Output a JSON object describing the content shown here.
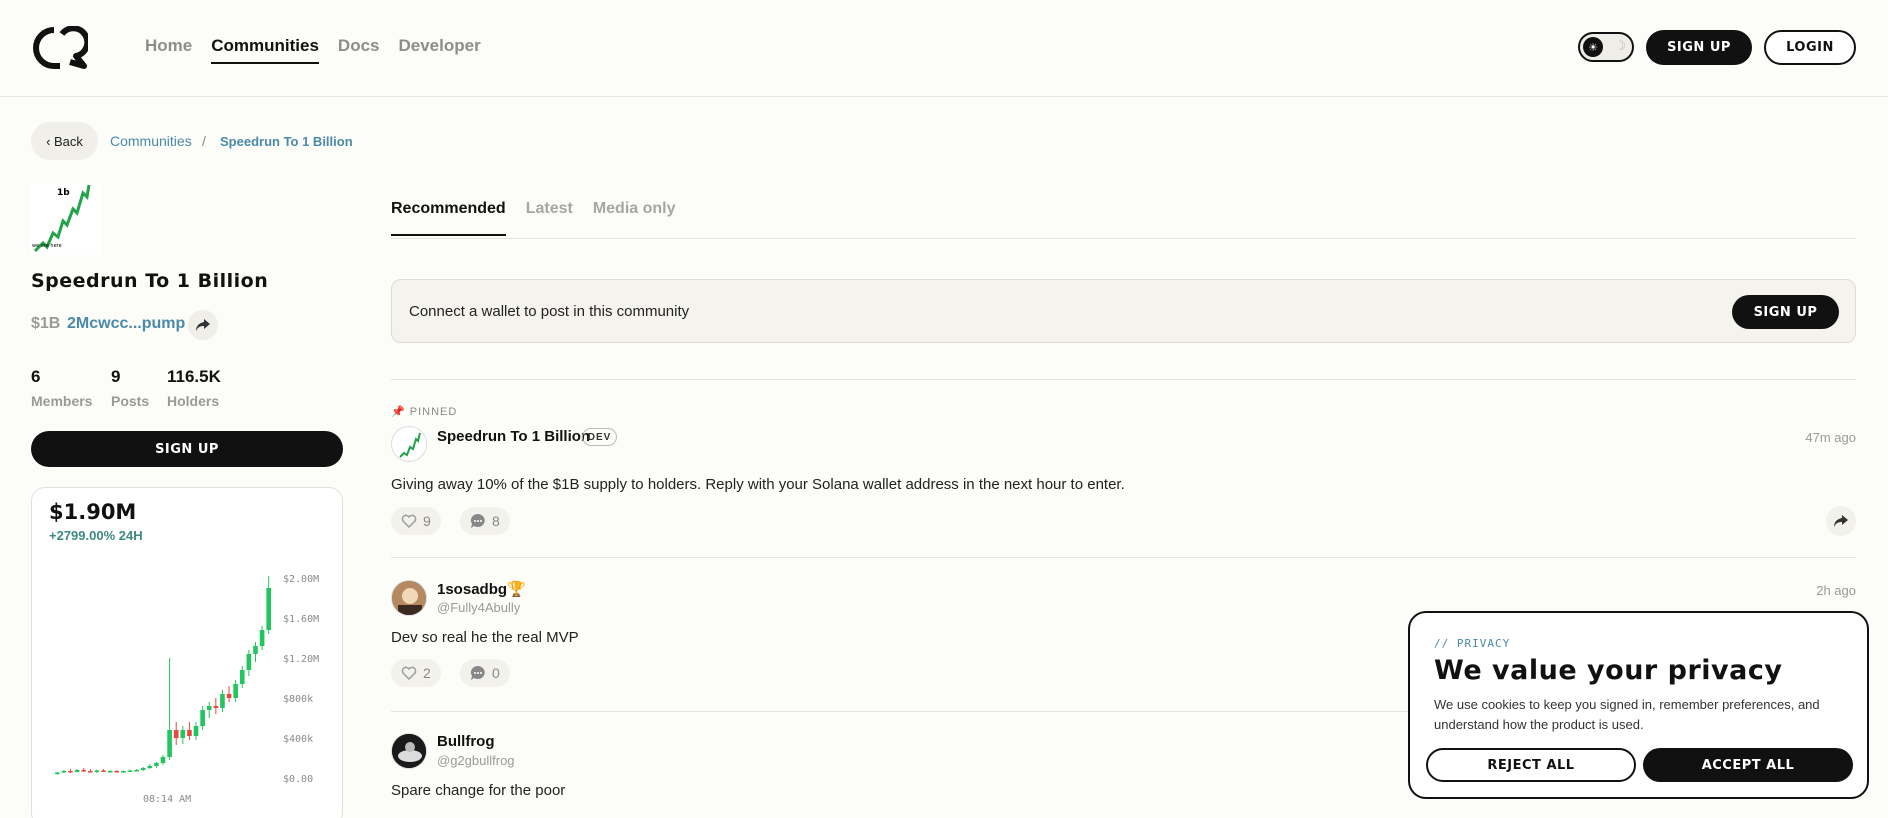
{
  "nav": {
    "items": [
      {
        "label": "Home",
        "active": false
      },
      {
        "label": "Communities",
        "active": true
      },
      {
        "label": "Docs",
        "active": false
      },
      {
        "label": "Developer",
        "active": false
      }
    ],
    "signup_label": "SIGN UP",
    "login_label": "LOGIN"
  },
  "breadcrumb": {
    "back_label": "Back",
    "parent": "Communities",
    "separator": "/",
    "current": "Speedrun To 1 Billion"
  },
  "community": {
    "image_label_top": "1b",
    "image_label_bottom": "we are here",
    "name": "Speedrun To 1 Billion",
    "ticker": "$1B",
    "contract": "2Mcwcc...pump",
    "stats": [
      {
        "value": "6",
        "label": "Members"
      },
      {
        "value": "9",
        "label": "Posts"
      },
      {
        "value": "116.5K",
        "label": "Holders"
      }
    ],
    "signup_label": "SIGN UP",
    "market_cap": "$1.90M",
    "change_24h": "+2799.00% 24H"
  },
  "chart_data": {
    "type": "candlestick",
    "y_tick_labels": [
      "$0.00",
      "$400k",
      "$800k",
      "$1.20M",
      "$1.60M",
      "$2.00M"
    ],
    "y_ticks": [
      0,
      400000,
      800000,
      1200000,
      1600000,
      2000000
    ],
    "ylim": [
      0,
      2100000
    ],
    "x_tick_labels": [
      "08:14 AM"
    ],
    "candles": [
      {
        "o": 40000,
        "h": 60000,
        "l": 30000,
        "c": 55000,
        "up": true
      },
      {
        "o": 55000,
        "h": 80000,
        "l": 50000,
        "c": 70000,
        "up": true
      },
      {
        "o": 70000,
        "h": 90000,
        "l": 50000,
        "c": 60000,
        "up": false
      },
      {
        "o": 60000,
        "h": 90000,
        "l": 55000,
        "c": 80000,
        "up": true
      },
      {
        "o": 80000,
        "h": 100000,
        "l": 60000,
        "c": 70000,
        "up": false
      },
      {
        "o": 70000,
        "h": 90000,
        "l": 55000,
        "c": 65000,
        "up": false
      },
      {
        "o": 65000,
        "h": 85000,
        "l": 50000,
        "c": 75000,
        "up": true
      },
      {
        "o": 75000,
        "h": 90000,
        "l": 60000,
        "c": 65000,
        "up": false
      },
      {
        "o": 65000,
        "h": 80000,
        "l": 55000,
        "c": 70000,
        "up": true
      },
      {
        "o": 70000,
        "h": 80000,
        "l": 55000,
        "c": 60000,
        "up": false
      },
      {
        "o": 60000,
        "h": 75000,
        "l": 50000,
        "c": 70000,
        "up": true
      },
      {
        "o": 70000,
        "h": 85000,
        "l": 60000,
        "c": 75000,
        "up": true
      },
      {
        "o": 75000,
        "h": 90000,
        "l": 65000,
        "c": 80000,
        "up": true
      },
      {
        "o": 80000,
        "h": 110000,
        "l": 70000,
        "c": 100000,
        "up": true
      },
      {
        "o": 100000,
        "h": 140000,
        "l": 90000,
        "c": 120000,
        "up": true
      },
      {
        "o": 120000,
        "h": 160000,
        "l": 100000,
        "c": 150000,
        "up": true
      },
      {
        "o": 150000,
        "h": 230000,
        "l": 130000,
        "c": 210000,
        "up": true
      },
      {
        "o": 210000,
        "h": 1200000,
        "l": 180000,
        "c": 480000,
        "up": true
      },
      {
        "o": 480000,
        "h": 560000,
        "l": 330000,
        "c": 400000,
        "up": false
      },
      {
        "o": 400000,
        "h": 520000,
        "l": 340000,
        "c": 480000,
        "up": true
      },
      {
        "o": 480000,
        "h": 560000,
        "l": 380000,
        "c": 420000,
        "up": false
      },
      {
        "o": 420000,
        "h": 560000,
        "l": 380000,
        "c": 520000,
        "up": true
      },
      {
        "o": 520000,
        "h": 720000,
        "l": 480000,
        "c": 680000,
        "up": true
      },
      {
        "o": 680000,
        "h": 760000,
        "l": 600000,
        "c": 720000,
        "up": true
      },
      {
        "o": 720000,
        "h": 800000,
        "l": 640000,
        "c": 700000,
        "up": false
      },
      {
        "o": 700000,
        "h": 880000,
        "l": 660000,
        "c": 840000,
        "up": true
      },
      {
        "o": 840000,
        "h": 920000,
        "l": 760000,
        "c": 800000,
        "up": false
      },
      {
        "o": 800000,
        "h": 980000,
        "l": 760000,
        "c": 940000,
        "up": true
      },
      {
        "o": 940000,
        "h": 1120000,
        "l": 900000,
        "c": 1080000,
        "up": true
      },
      {
        "o": 1080000,
        "h": 1280000,
        "l": 1020000,
        "c": 1240000,
        "up": true
      },
      {
        "o": 1240000,
        "h": 1360000,
        "l": 1160000,
        "c": 1320000,
        "up": true
      },
      {
        "o": 1320000,
        "h": 1520000,
        "l": 1280000,
        "c": 1480000,
        "up": true
      },
      {
        "o": 1480000,
        "h": 2020000,
        "l": 1440000,
        "c": 1900000,
        "up": true
      }
    ],
    "colors": {
      "up": "#22c55e",
      "down": "#ef4444"
    }
  },
  "feed": {
    "tabs": [
      {
        "label": "Recommended",
        "active": true
      },
      {
        "label": "Latest",
        "active": false
      },
      {
        "label": "Media only",
        "active": false
      }
    ],
    "connect_prompt": "Connect a wallet to post in this community",
    "connect_signup_label": "SIGN UP",
    "pinned_label": "PINNED",
    "posts": [
      {
        "name": "Speedrun To 1 Billion",
        "badge": "DEV",
        "time": "47m ago",
        "text": "Giving away 10% of the $1B supply to holders. Reply with your Solana wallet address in the next hour to enter.",
        "likes": "9",
        "comments": "8"
      },
      {
        "name": "1sosadbg🏆",
        "handle": "@Fully4Abully",
        "time": "2h ago",
        "text": "Dev so real he the real MVP",
        "likes": "2",
        "comments": "0"
      },
      {
        "name": "Bullfrog",
        "handle": "@g2gbullfrog",
        "text": "Spare change for the poor"
      }
    ]
  },
  "privacy": {
    "kicker": "// PRIVACY",
    "title": "We value your privacy",
    "text": "We use cookies to keep you signed in, remember preferences, and understand how the product is used.",
    "reject_label": "REJECT ALL",
    "accept_label": "ACCEPT ALL"
  },
  "colors": {
    "accent": "#4a8aa8",
    "positive": "#3d8a85",
    "dark": "#111111",
    "background": "#fcfcf9"
  }
}
